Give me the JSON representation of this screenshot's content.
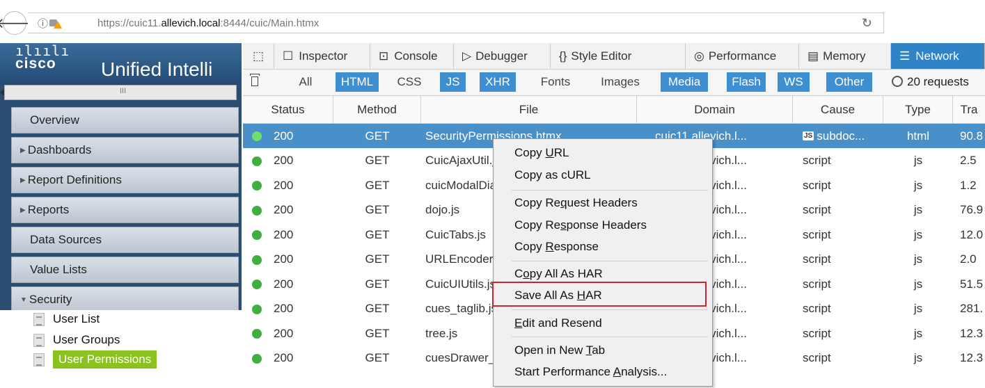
{
  "browser": {
    "url_prefix": "https://cuic11.",
    "url_domain": "allevich.local",
    "url_suffix": ":8444/cuic/Main.htmx"
  },
  "cisco": {
    "logo_bars": "ılıılı",
    "logo_word": "cisco",
    "app_title": "Unified Intelli"
  },
  "nav": {
    "items": [
      {
        "label": "Overview",
        "arrow": ""
      },
      {
        "label": "Dashboards",
        "arrow": "▶"
      },
      {
        "label": "Report Definitions",
        "arrow": "▶"
      },
      {
        "label": "Reports",
        "arrow": "▶"
      },
      {
        "label": "Data Sources",
        "arrow": ""
      },
      {
        "label": "Value Lists",
        "arrow": ""
      },
      {
        "label": "Security",
        "arrow": "▼"
      }
    ],
    "security_children": [
      "User List",
      "User Groups",
      "User Permissions"
    ]
  },
  "devtools": {
    "tabs": [
      "Inspector",
      "Console",
      "Debugger",
      "Style Editor",
      "Performance",
      "Memory",
      "Network"
    ],
    "filters": [
      {
        "label": "All",
        "on": false
      },
      {
        "label": "HTML",
        "on": true
      },
      {
        "label": "CSS",
        "on": false
      },
      {
        "label": "JS",
        "on": true
      },
      {
        "label": "XHR",
        "on": true
      },
      {
        "label": "Fonts",
        "on": false
      },
      {
        "label": "Images",
        "on": false
      },
      {
        "label": "Media",
        "on": true
      },
      {
        "label": "Flash",
        "on": true
      },
      {
        "label": "WS",
        "on": true
      },
      {
        "label": "Other",
        "on": true
      }
    ],
    "request_count": "20 requests",
    "columns": [
      "Status",
      "Method",
      "File",
      "Domain",
      "Cause",
      "Type",
      "Tra"
    ],
    "rows": [
      {
        "status": "200",
        "method": "GET",
        "file": "SecurityPermissions.htmx",
        "domain": "cuic11.allevich.l...",
        "cause": "subdoc...",
        "type": "html",
        "size": "90.8"
      },
      {
        "status": "200",
        "method": "GET",
        "file": "CuicAjaxUtil.js",
        "domain": "cuic11.allevich.l...",
        "cause": "script",
        "type": "js",
        "size": "2.5"
      },
      {
        "status": "200",
        "method": "GET",
        "file": "cuicModalDialog.js",
        "domain": "cuic11.allevich.l...",
        "cause": "script",
        "type": "js",
        "size": "1.2"
      },
      {
        "status": "200",
        "method": "GET",
        "file": "dojo.js",
        "domain": "cuic11.allevich.l...",
        "cause": "script",
        "type": "js",
        "size": "76.9"
      },
      {
        "status": "200",
        "method": "GET",
        "file": "CuicTabs.js",
        "domain": "cuic11.allevich.l...",
        "cause": "script",
        "type": "js",
        "size": "12.0"
      },
      {
        "status": "200",
        "method": "GET",
        "file": "URLEncoder.js",
        "domain": "cuic11.allevich.l...",
        "cause": "script",
        "type": "js",
        "size": "2.0"
      },
      {
        "status": "200",
        "method": "GET",
        "file": "CuicUIUtils.js",
        "domain": "cuic11.allevich.l...",
        "cause": "script",
        "type": "js",
        "size": "51.5"
      },
      {
        "status": "200",
        "method": "GET",
        "file": "cues_taglib.js",
        "domain": "cuic11.allevich.l...",
        "cause": "script",
        "type": "js",
        "size": "281."
      },
      {
        "status": "200",
        "method": "GET",
        "file": "tree.js",
        "domain": "cuic11.allevich.l...",
        "cause": "script",
        "type": "js",
        "size": "12.3"
      },
      {
        "status": "200",
        "method": "GET",
        "file": "cuesDrawer_tree_tpl.js",
        "domain": "cuic11.allevich.l...",
        "cause": "script",
        "type": "js",
        "size": "12.3"
      }
    ]
  },
  "context_menu": {
    "copy_url": {
      "pre": "Copy ",
      "u": "U",
      "post": "RL"
    },
    "copy_curl": "Copy as cURL",
    "copy_req_headers": {
      "pre": "Copy Re",
      "u": "q",
      "post": "uest Headers"
    },
    "copy_resp_headers": {
      "pre": "Copy Re",
      "u": "s",
      "post": "ponse Headers"
    },
    "copy_response": {
      "pre": "Copy ",
      "u": "R",
      "post": "esponse"
    },
    "copy_all_har": {
      "pre": "C",
      "u": "o",
      "post": "py All As HAR"
    },
    "save_all_har": {
      "pre": "Save All As ",
      "u": "H",
      "post": "AR"
    },
    "edit_resend": {
      "pre": "",
      "u": "E",
      "post": "dit and Resend"
    },
    "open_new_tab": {
      "pre": "Open in New ",
      "u": "T",
      "post": "ab"
    },
    "start_perf": {
      "pre": "Start Performance ",
      "u": "A",
      "post": "nalysis..."
    }
  },
  "colors": {
    "selected_row": "#4a90c8",
    "highlight_border": "#c8242a",
    "status_dot": "#3fb040",
    "user_permissions_bg": "#8bc21f"
  }
}
